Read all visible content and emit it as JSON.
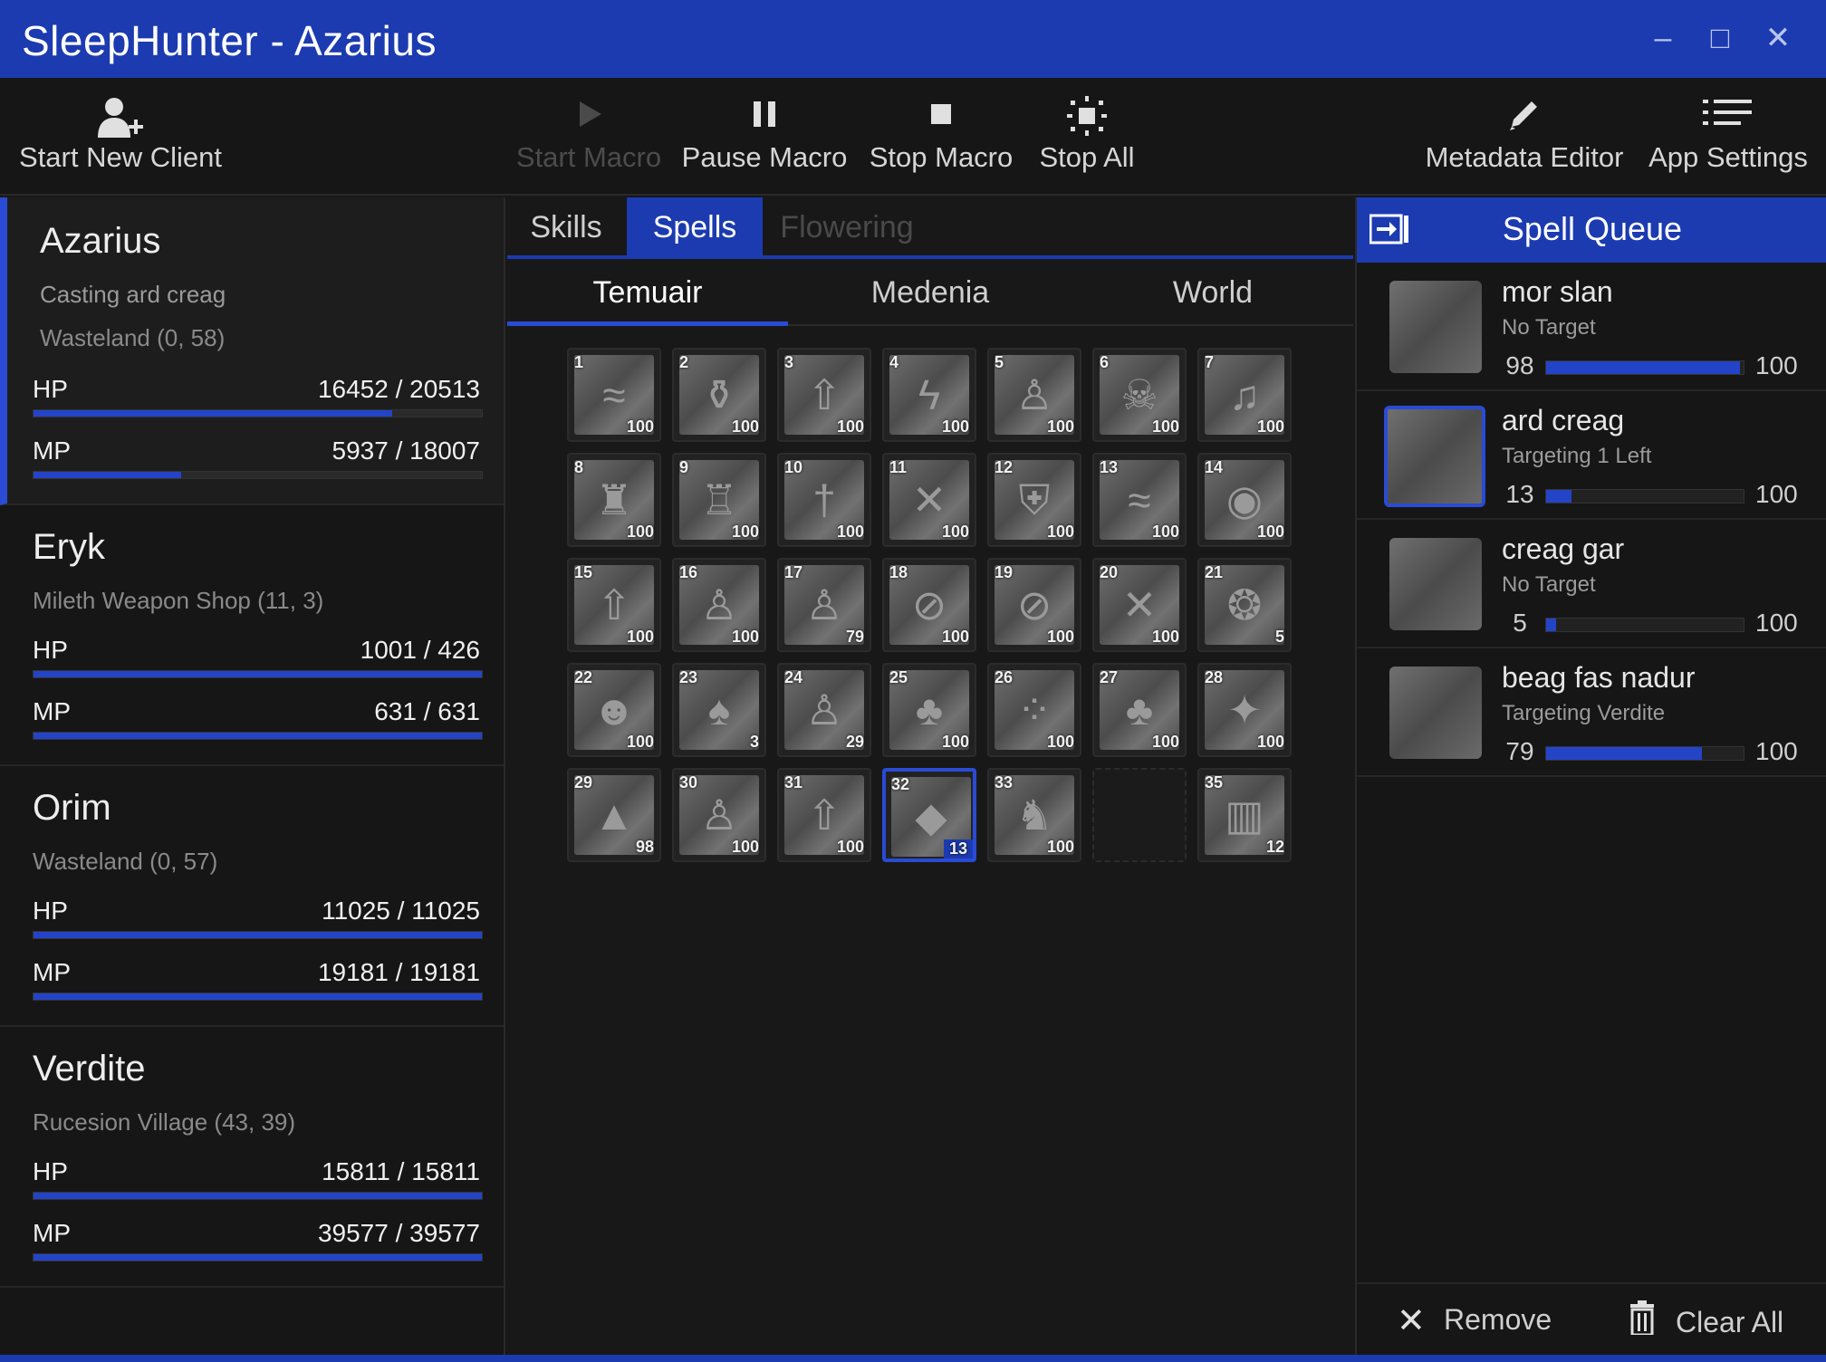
{
  "window": {
    "title": "SleepHunter - Azarius",
    "minimize": "–",
    "maximize": "□",
    "close": "✕"
  },
  "toolbar": {
    "start_client": "Start New Client",
    "start_macro": "Start Macro",
    "pause_macro": "Pause Macro",
    "stop_macro": "Stop Macro",
    "stop_all": "Stop All",
    "metadata_editor": "Metadata Editor",
    "app_settings": "App Settings"
  },
  "clients": [
    {
      "name": "Azarius",
      "status": "Casting ard creag",
      "location": "Wasteland (0, 58)",
      "hp_label": "HP",
      "hp": "16452 / 20513",
      "hp_fraction": 0.8,
      "mp_label": "MP",
      "mp": "5937 / 18007",
      "mp_fraction": 0.33
    },
    {
      "name": "Eryk",
      "status": "",
      "location": "Mileth Weapon Shop (11, 3)",
      "hp_label": "HP",
      "hp": "1001 / 426",
      "hp_fraction": 1.0,
      "mp_label": "MP",
      "mp": "631 / 631",
      "mp_fraction": 1.0
    },
    {
      "name": "Orim",
      "status": "",
      "location": "Wasteland (0, 57)",
      "hp_label": "HP",
      "hp": "11025 / 11025",
      "hp_fraction": 1.0,
      "mp_label": "MP",
      "mp": "19181 / 19181",
      "mp_fraction": 1.0
    },
    {
      "name": "Verdite",
      "status": "",
      "location": "Rucesion Village (43, 39)",
      "hp_label": "HP",
      "hp": "15811 / 15811",
      "hp_fraction": 1.0,
      "mp_label": "MP",
      "mp": "39577 / 39577",
      "mp_fraction": 1.0
    }
  ],
  "tabs": {
    "skills": "Skills",
    "spells": "Spells",
    "flowering": "Flowering"
  },
  "subtabs": {
    "temuair": "Temuair",
    "medenia": "Medenia",
    "world": "World"
  },
  "spells": [
    {
      "num": "1",
      "level": "100",
      "icon": "wave-icon"
    },
    {
      "num": "2",
      "level": "100",
      "icon": "potion-icon"
    },
    {
      "num": "3",
      "level": "100",
      "icon": "arrow-icon"
    },
    {
      "num": "4",
      "level": "100",
      "icon": "lightning-icon"
    },
    {
      "num": "5",
      "level": "100",
      "icon": "figure-icon"
    },
    {
      "num": "6",
      "level": "100",
      "icon": "creature-icon"
    },
    {
      "num": "7",
      "level": "100",
      "icon": "music-icon"
    },
    {
      "num": "8",
      "level": "100",
      "icon": "statue-icon"
    },
    {
      "num": "9",
      "level": "100",
      "icon": "armor-icon"
    },
    {
      "num": "10",
      "level": "100",
      "icon": "sword-icon"
    },
    {
      "num": "11",
      "level": "100",
      "icon": "crossed-swords-icon"
    },
    {
      "num": "12",
      "level": "100",
      "icon": "shield-icon"
    },
    {
      "num": "13",
      "level": "100",
      "icon": "wave-icon"
    },
    {
      "num": "14",
      "level": "100",
      "icon": "eye-icon"
    },
    {
      "num": "15",
      "level": "100",
      "icon": "arrow-icon"
    },
    {
      "num": "16",
      "level": "100",
      "icon": "figure-icon"
    },
    {
      "num": "17",
      "level": "79",
      "icon": "figure-icon"
    },
    {
      "num": "18",
      "level": "100",
      "icon": "no-icon"
    },
    {
      "num": "19",
      "level": "100",
      "icon": "no-icon"
    },
    {
      "num": "20",
      "level": "100",
      "icon": "cross-icon"
    },
    {
      "num": "21",
      "level": "5",
      "icon": "ring-icon"
    },
    {
      "num": "22",
      "level": "100",
      "icon": "face-icon"
    },
    {
      "num": "23",
      "level": "3",
      "icon": "mushroom-icon"
    },
    {
      "num": "24",
      "level": "29",
      "icon": "figure-icon"
    },
    {
      "num": "25",
      "level": "100",
      "icon": "tree-icon"
    },
    {
      "num": "26",
      "level": "100",
      "icon": "dots-icon"
    },
    {
      "num": "27",
      "level": "100",
      "icon": "tree-icon"
    },
    {
      "num": "28",
      "level": "100",
      "icon": "sparkle-icon"
    },
    {
      "num": "29",
      "level": "98",
      "icon": "mountain-icon"
    },
    {
      "num": "30",
      "level": "100",
      "icon": "figure-icon"
    },
    {
      "num": "31",
      "level": "100",
      "icon": "arrow-icon"
    },
    {
      "num": "32",
      "level": "13",
      "icon": "rock-icon",
      "selected": true
    },
    {
      "num": "33",
      "level": "100",
      "icon": "beast-icon"
    },
    {
      "num": "",
      "level": "",
      "icon": "",
      "empty": true
    },
    {
      "num": "35",
      "level": "12",
      "icon": "pillar-icon"
    }
  ],
  "queue": {
    "title": "Spell Queue",
    "items": [
      {
        "name": "mor slan",
        "target": "No Target",
        "current": "98",
        "max": "100",
        "fraction": 0.98
      },
      {
        "name": "ard creag",
        "target": "Targeting 1 Left",
        "current": "13",
        "max": "100",
        "fraction": 0.13,
        "selected": true
      },
      {
        "name": "creag gar",
        "target": "No Target",
        "current": "5",
        "max": "100",
        "fraction": 0.05
      },
      {
        "name": "beag fas nadur",
        "target": "Targeting Verdite",
        "current": "79",
        "max": "100",
        "fraction": 0.79
      }
    ],
    "remove": "Remove",
    "clear_all": "Clear All"
  },
  "colors": {
    "accent": "#1c3bb0",
    "bar": "#2444c8"
  }
}
